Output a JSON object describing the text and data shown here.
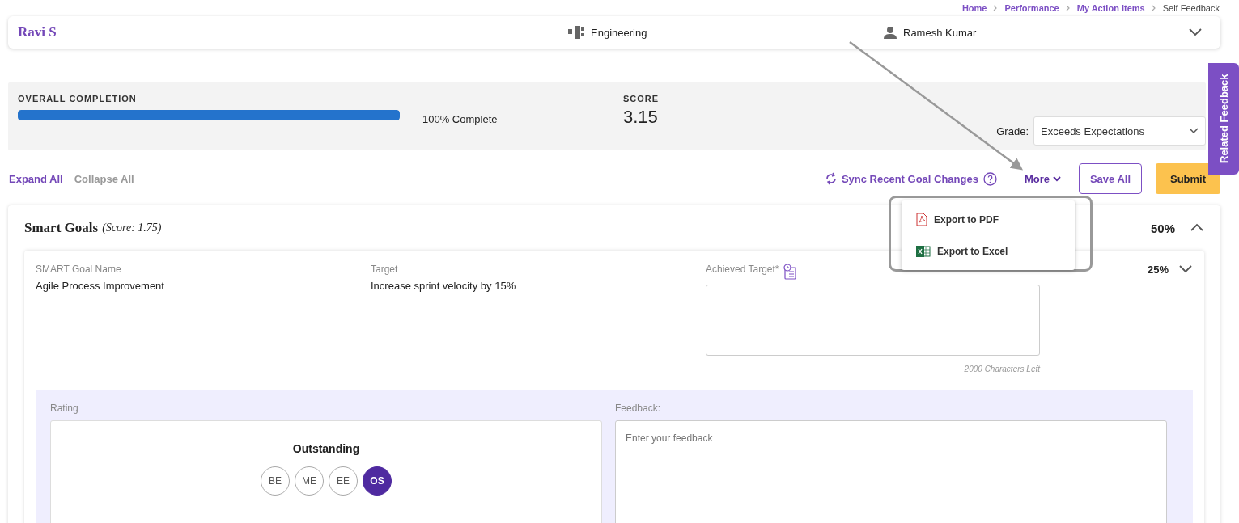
{
  "breadcrumb": [
    {
      "label": "Home",
      "current": false
    },
    {
      "label": "Performance",
      "current": false
    },
    {
      "label": "My Action Items",
      "current": false
    },
    {
      "label": "Self Feedback",
      "current": true
    }
  ],
  "header": {
    "name": "Ravi S",
    "department": "Engineering",
    "manager": "Ramesh Kumar",
    "expanded": false
  },
  "completion": {
    "label": "OVERALL COMPLETION",
    "level": 1,
    "reading": "100% Complete",
    "score_label": "SCORE",
    "score": "3.15",
    "grade_label": "Grade:",
    "grade": "Exceeds Expectations"
  },
  "toolbar": {
    "expand": "Expand All",
    "collapse": "Collapse All",
    "sync": "Sync Recent Goal Changes",
    "more": "More",
    "save": "Save All",
    "submit": "Submit"
  },
  "more_menu": {
    "open": true,
    "items": [
      {
        "kind": "pdf",
        "label": "Export to PDF"
      },
      {
        "kind": "excel",
        "label": "Export to Excel"
      }
    ]
  },
  "section": {
    "title": "Smart Goals",
    "score": "(Score: 1.75)",
    "percent": "50%",
    "expanded": true,
    "goal": {
      "name_label": "SMART Goal Name",
      "name": "Agile Process Improvement",
      "target_label": "Target",
      "target": "Increase sprint velocity by 15%",
      "achieved_label": "Achieved Target*",
      "chars_left": "2000 Characters Left",
      "percent": "25%",
      "expanded": false,
      "rating": {
        "label": "Rating",
        "current": "Outstanding",
        "options": [
          {
            "label": "BE",
            "selected": false
          },
          {
            "label": "ME",
            "selected": false
          },
          {
            "label": "EE",
            "selected": false
          },
          {
            "label": "OS",
            "selected": true
          }
        ]
      },
      "feedback": {
        "label": "Feedback:",
        "placeholder": "Enter your feedback"
      }
    }
  },
  "side_tab": {
    "label": "Related Feedback"
  }
}
